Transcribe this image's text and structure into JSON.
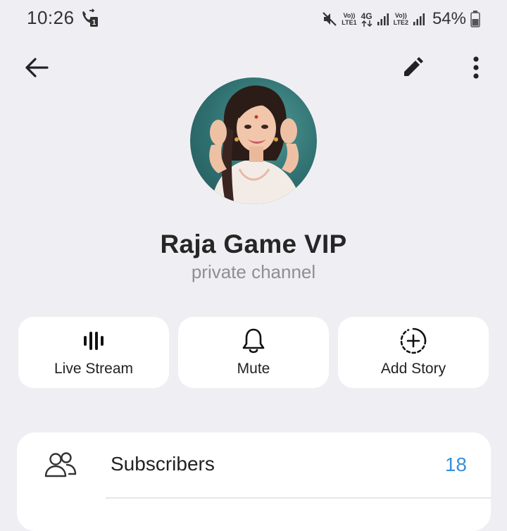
{
  "status_bar": {
    "time": "10:26",
    "sim1_label_top": "Vo))",
    "sim1_label_bottom": "LTE1",
    "network_type": "4G",
    "sim2_label_top": "Vo))",
    "sim2_label_bottom": "LTE2",
    "battery_percent": "54%"
  },
  "header": {
    "channel_name": "Raja Game VIP",
    "channel_type": "private channel"
  },
  "actions": [
    {
      "label": "Live Stream",
      "icon": "live-stream-icon"
    },
    {
      "label": "Mute",
      "icon": "bell-icon"
    },
    {
      "label": "Add Story",
      "icon": "add-story-icon"
    }
  ],
  "info": {
    "subscribers_label": "Subscribers",
    "subscribers_count": "18"
  },
  "colors": {
    "background": "#efeff3",
    "card": "#ffffff",
    "accent": "#3a8fd8",
    "avatar_bg": "#2f6f70"
  }
}
